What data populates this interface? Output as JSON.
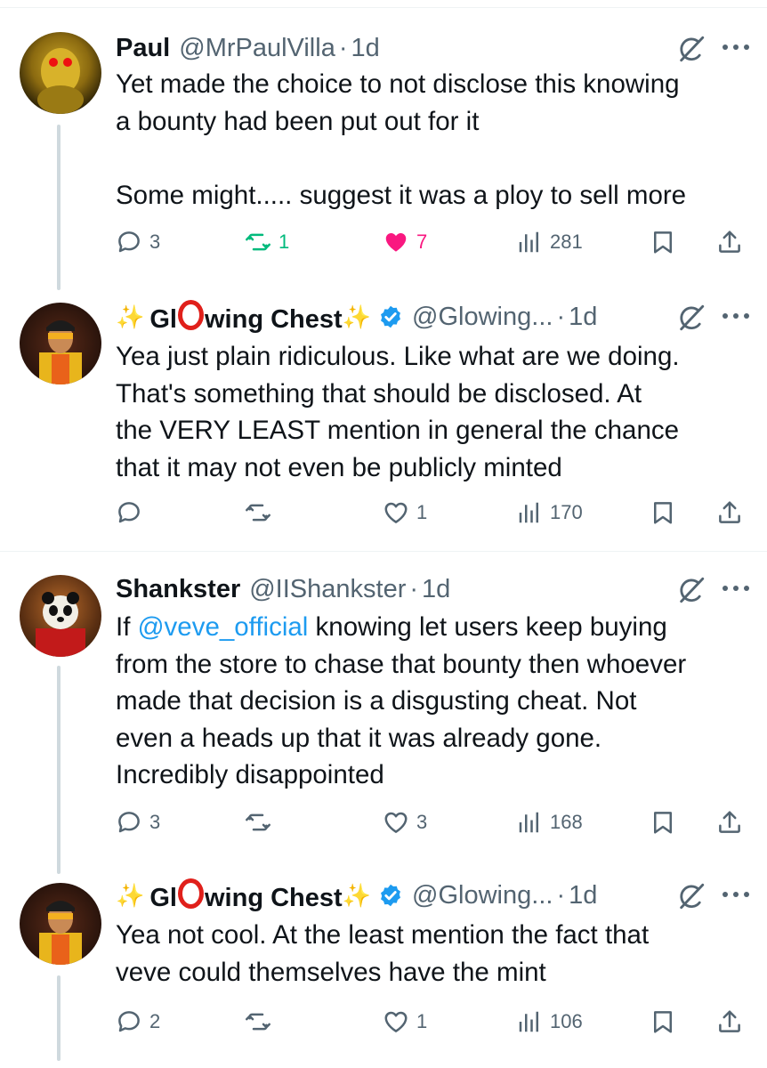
{
  "tweets": [
    {
      "name": "Paul",
      "handle": "@MrPaulVilla",
      "sep": "·",
      "time": "1d",
      "text": "Yet made the choice to not disclose this knowing\na bounty had been put out for it\n\nSome might..... suggest it was a ploy to sell more",
      "replies": "3",
      "reposts": "1",
      "likes": "7",
      "views": "281",
      "reposted": true,
      "liked": true
    },
    {
      "name_prefix": "Gl",
      "name_suffix": "wing Chest",
      "handle": "@Glowing...",
      "sep": "·",
      "time": "1d",
      "verified": true,
      "text": "Yea just plain ridiculous. Like what are we doing.\nThat's something that should be disclosed. At\nthe VERY LEAST mention in general the chance\nthat it may not even be publicly minted",
      "replies": "",
      "reposts": "",
      "likes": "1",
      "views": "170"
    },
    {
      "name": "Shankster",
      "handle": "@IIShankster",
      "sep": "·",
      "time": "1d",
      "text_before": "If ",
      "mention": "@veve_official",
      "text_after": " knowing let users keep buying\nfrom the store to chase that bounty then whoever\nmade that decision is a disgusting cheat. Not\neven a heads up that it was already gone.\nIncredibly disappointed",
      "replies": "3",
      "reposts": "",
      "likes": "3",
      "views": "168"
    },
    {
      "name_prefix": "Gl",
      "name_suffix": "wing Chest",
      "handle": "@Glowing...",
      "sep": "·",
      "time": "1d",
      "verified": true,
      "text": "Yea not cool. At the least mention the fact that\nveve could themselves have the mint",
      "replies": "2",
      "reposts": "",
      "likes": "1",
      "views": "106"
    }
  ],
  "colors": {
    "text": "#0f1419",
    "muted": "#536471",
    "link": "#1d9bf0",
    "repost_active": "#00ba7c",
    "like_active": "#f91880",
    "verified": "#1d9bf0"
  },
  "icons": [
    "reply-icon",
    "repost-icon",
    "like-icon",
    "views-icon",
    "bookmark-icon",
    "share-icon",
    "grok-icon",
    "more-icon",
    "verified-badge-icon"
  ]
}
